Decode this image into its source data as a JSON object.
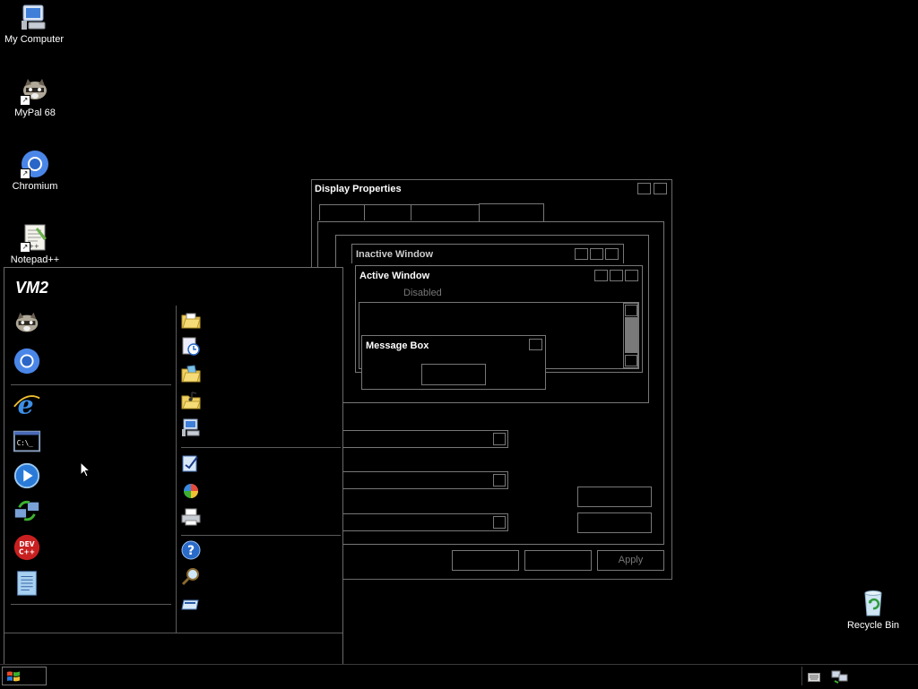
{
  "desktop": {
    "icons": [
      {
        "label": "My Computer",
        "icon": "computer-icon"
      },
      {
        "label": "MyPal 68",
        "icon": "raccoon-icon"
      },
      {
        "label": "Chromium",
        "icon": "chromium-icon"
      },
      {
        "label": "Notepad++",
        "icon": "notepad-plus-plus-icon"
      },
      {
        "label": "Recycle Bin",
        "icon": "recycle-bin-icon"
      }
    ]
  },
  "display_properties": {
    "title": "Display Properties",
    "preview": {
      "inactive_title": "Inactive Window",
      "active_title": "Active Window",
      "disabled_text": "Disabled",
      "message_box_title": "Message Box"
    },
    "buttons": {
      "apply": "Apply"
    }
  },
  "start_menu": {
    "user_name": "VM2",
    "pinned": [
      {
        "icon": "raccoon-icon"
      },
      {
        "icon": "chromium-icon"
      }
    ],
    "recent": [
      {
        "icon": "internet-explorer-icon"
      },
      {
        "icon": "command-prompt-icon"
      },
      {
        "icon": "media-player-icon"
      },
      {
        "icon": "transfer-wizard-icon"
      },
      {
        "icon": "dev-cpp-icon"
      },
      {
        "icon": "notepad-icon"
      }
    ],
    "places": [
      {
        "icon": "documents-folder-icon"
      },
      {
        "icon": "recent-documents-icon"
      },
      {
        "icon": "pictures-folder-icon"
      },
      {
        "icon": "music-folder-icon"
      },
      {
        "icon": "my-computer-icon"
      },
      {
        "icon": "control-panel-icon"
      },
      {
        "icon": "programs-icon"
      },
      {
        "icon": "printers-icon"
      },
      {
        "icon": "help-icon"
      },
      {
        "icon": "search-icon"
      },
      {
        "icon": "run-icon"
      }
    ],
    "dev_cpp_text": "DEV C++"
  },
  "taskbar": {
    "tray_icons": [
      "keyboard-icon",
      "network-icon"
    ]
  }
}
